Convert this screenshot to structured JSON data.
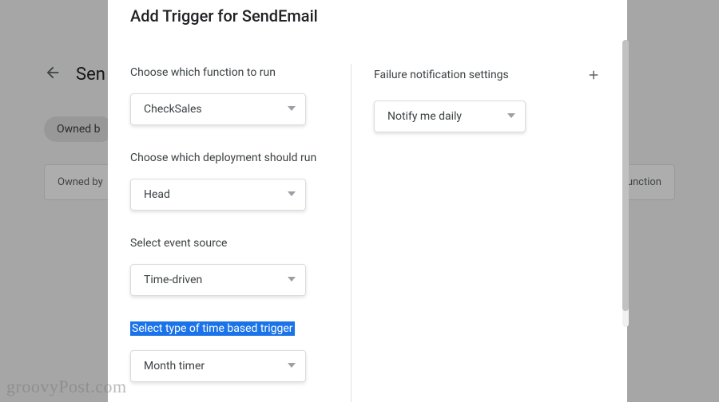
{
  "background": {
    "back_title": "Sen",
    "chip_label": "Owned b",
    "table_col_left": "Owned by",
    "table_col_right": "unction"
  },
  "dialog": {
    "title": "Add Trigger for SendEmail",
    "left": {
      "function_label": "Choose which function to run",
      "function_value": "CheckSales",
      "deployment_label": "Choose which deployment should run",
      "deployment_value": "Head",
      "event_source_label": "Select event source",
      "event_source_value": "Time-driven",
      "time_trigger_label": "Select type of time based trigger",
      "time_trigger_value": "Month timer"
    },
    "right": {
      "failure_label": "Failure notification settings",
      "failure_value": "Notify me daily"
    }
  },
  "watermark": "groovyPost.com"
}
